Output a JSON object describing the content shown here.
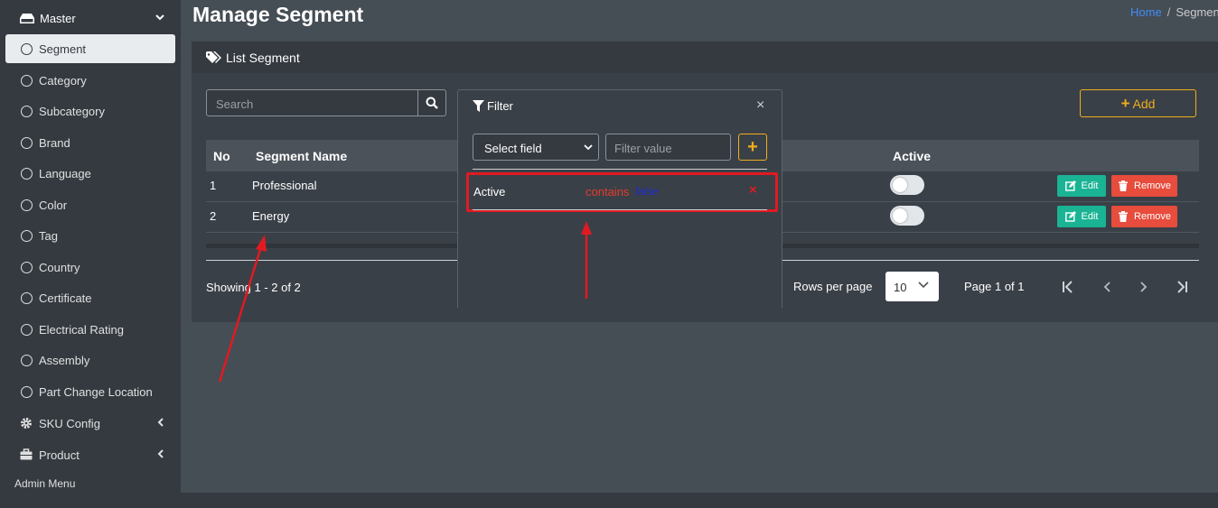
{
  "sidebar": {
    "master_label": "Master",
    "items": [
      {
        "label": "Segment"
      },
      {
        "label": "Category"
      },
      {
        "label": "Subcategory"
      },
      {
        "label": "Brand"
      },
      {
        "label": "Language"
      },
      {
        "label": "Color"
      },
      {
        "label": "Tag"
      },
      {
        "label": "Country"
      },
      {
        "label": "Certificate"
      },
      {
        "label": "Electrical Rating"
      },
      {
        "label": "Assembly"
      },
      {
        "label": "Part Change Location"
      }
    ],
    "groups": [
      {
        "label": "SKU Config",
        "icon": "gear-icon"
      },
      {
        "label": "Product",
        "icon": "briefcase-icon"
      }
    ],
    "admin_header": "Admin Menu"
  },
  "page": {
    "title": "Manage Segment",
    "breadcrumb": {
      "home": "Home",
      "separator": "/",
      "current": "Segmen"
    }
  },
  "card": {
    "title": "List Segment",
    "search_placeholder": "Search",
    "add_label": "Add",
    "columns": [
      "No",
      "Segment Name",
      "Active"
    ],
    "rows": [
      {
        "no": "1",
        "name": "Professional",
        "active": false,
        "edit": "Edit",
        "remove": "Remove"
      },
      {
        "no": "2",
        "name": "Energy",
        "active": false,
        "edit": "Edit",
        "remove": "Remove"
      }
    ],
    "showing": "Showing 1 - 2 of 2",
    "rows_per_page_label": "Rows per page",
    "rows_per_page_value": "10",
    "page_info": "Page 1 of 1"
  },
  "filter": {
    "title": "Filter",
    "close": "×",
    "select_field": "Select field",
    "value_placeholder": "Filter value",
    "add": "+",
    "rule": {
      "field": "Active",
      "operator": "contains",
      "value": "false",
      "remove": "×"
    }
  },
  "colors": {
    "accent": "#f0ad1e",
    "edit": "#1ab394",
    "remove": "#e74c3c",
    "annotation": "#e01a22",
    "link": "#3f8ef7"
  }
}
